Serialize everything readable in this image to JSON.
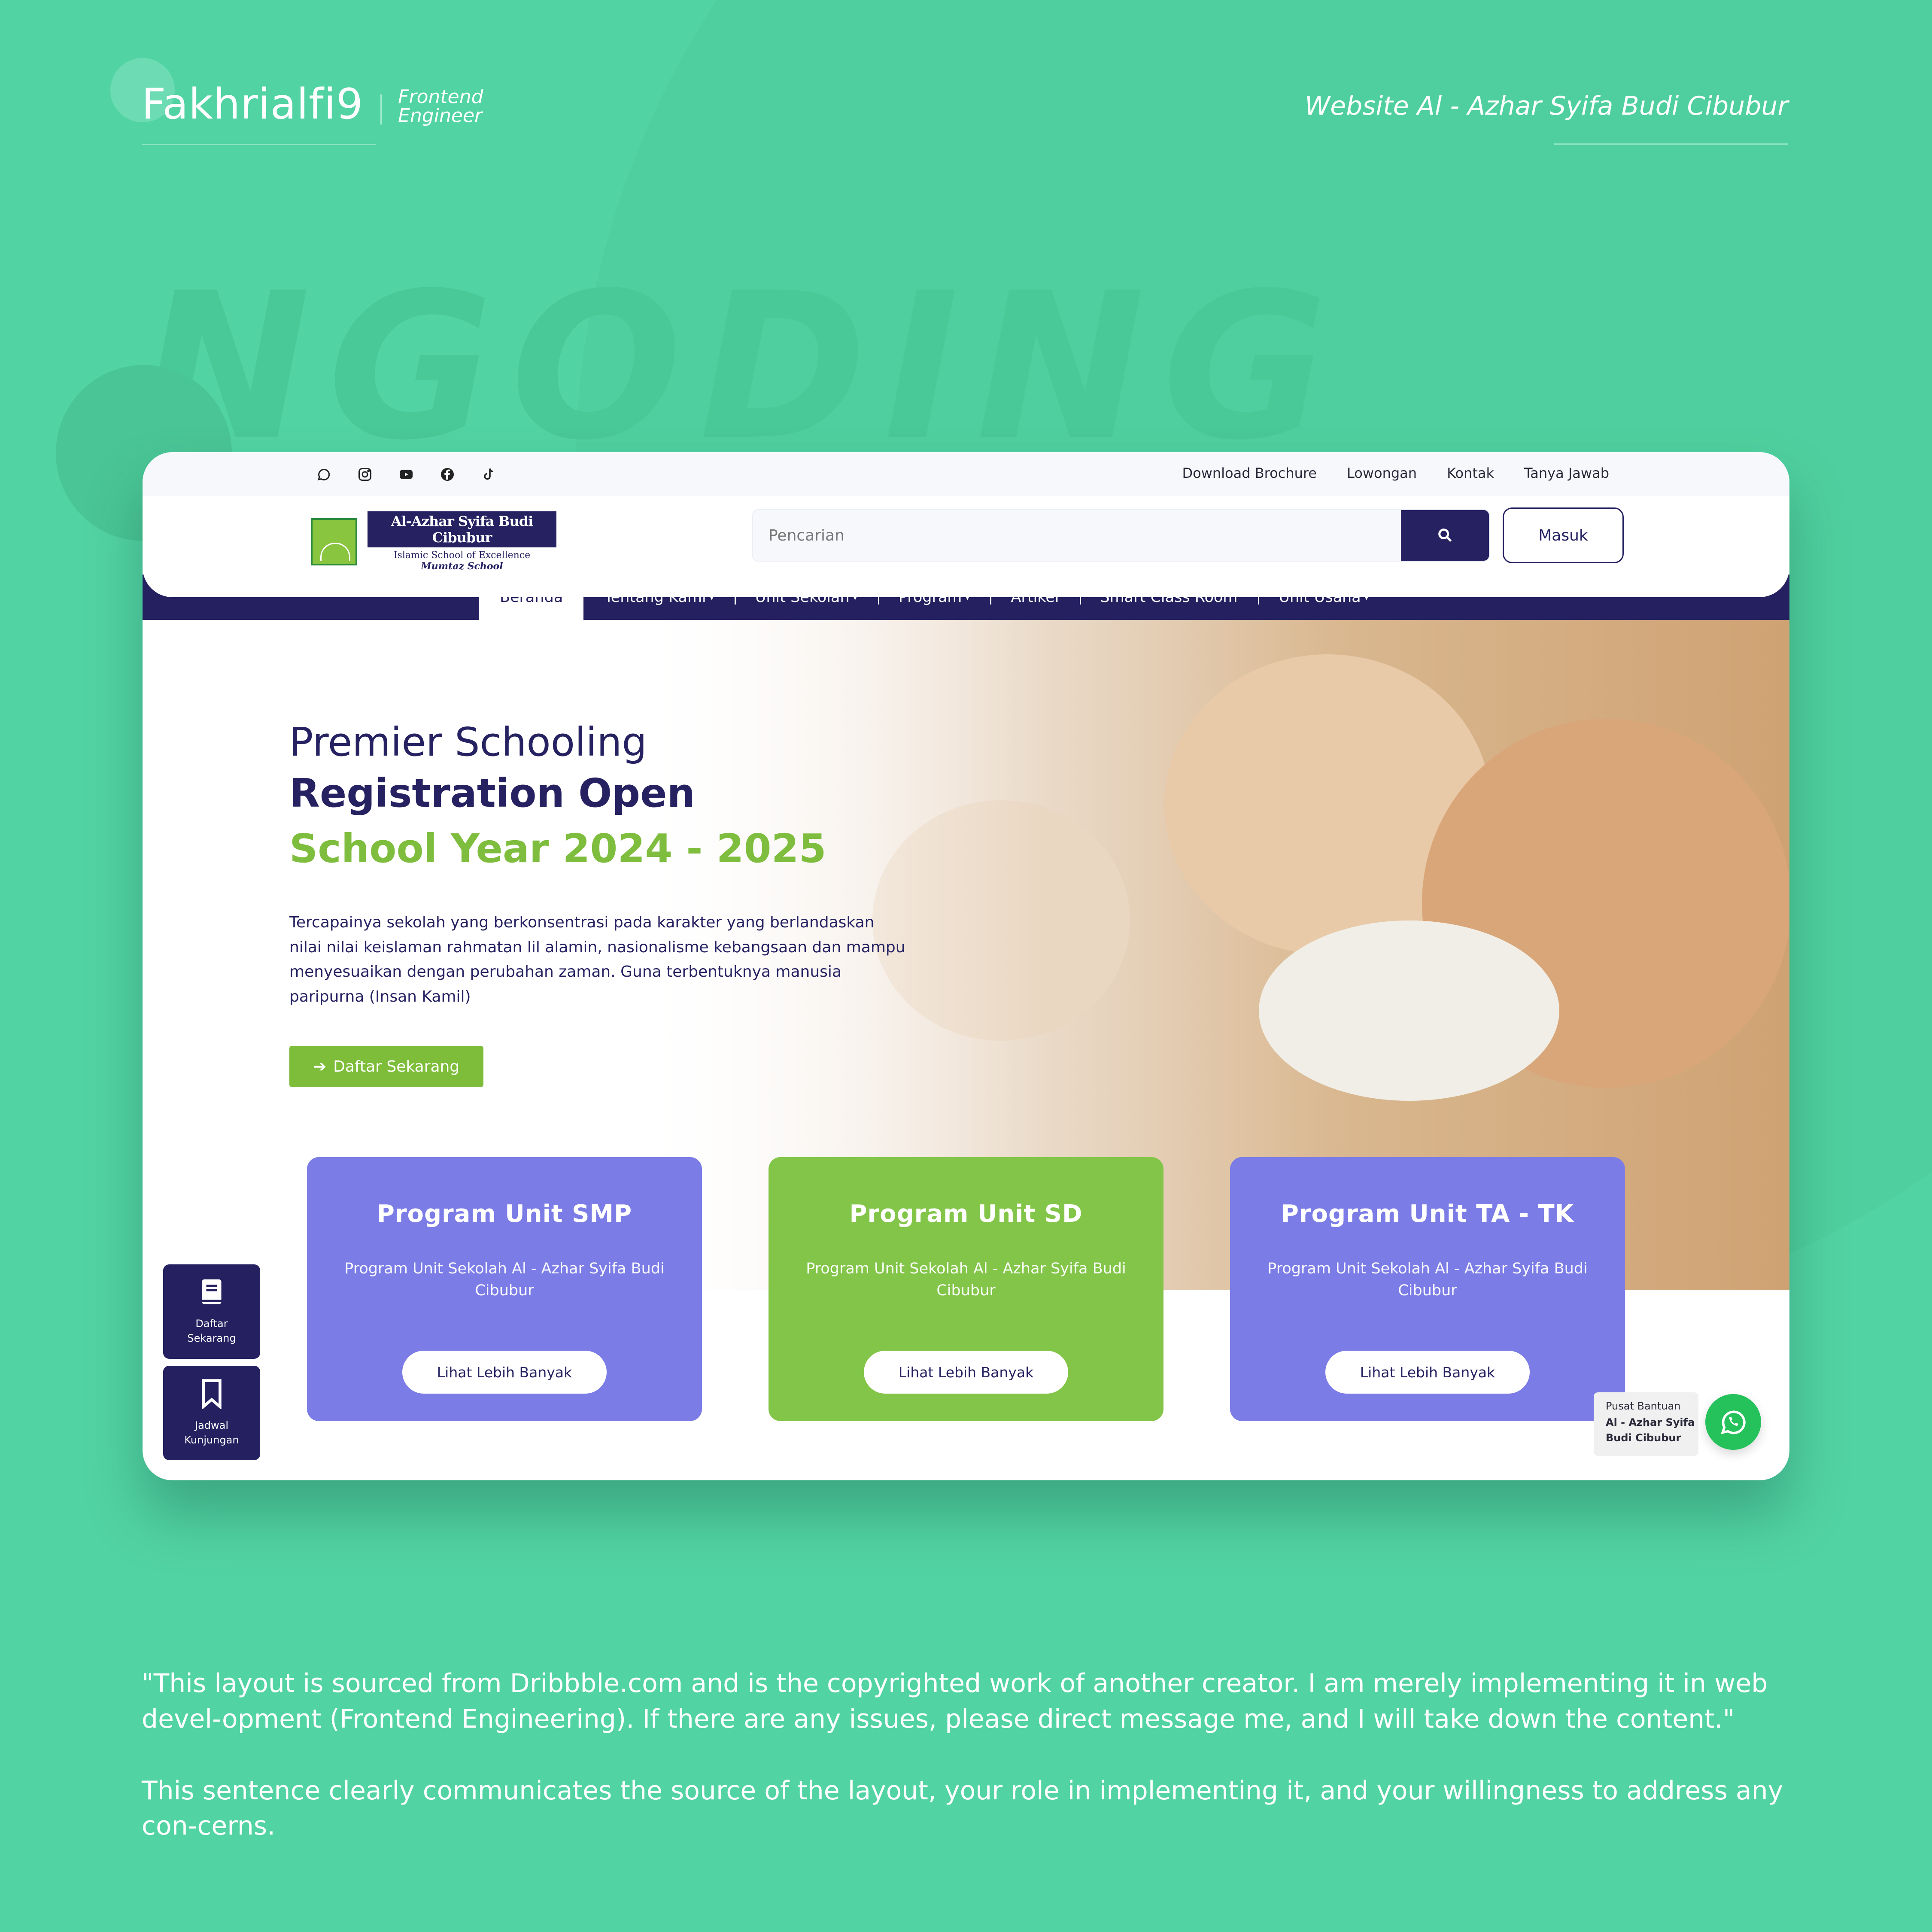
{
  "author": {
    "name": "Fakhrialfi9",
    "role_line1": "Frontend",
    "role_line2": "Engineer"
  },
  "page_caption": "Website Al - Azhar Syifa Budi Cibubur",
  "deco_text": "NGODING",
  "topbar": {
    "social_icons": [
      "whatsapp-icon",
      "instagram-icon",
      "youtube-icon",
      "facebook-icon",
      "tiktok-icon"
    ],
    "links": [
      "Download Brochure",
      "Lowongan",
      "Kontak",
      "Tanya Jawab"
    ]
  },
  "logo": {
    "title": "Al-Azhar Syifa Budi Cibubur",
    "subtitle": "Islamic School of Excellence",
    "subtitle2": "Mumtaz School"
  },
  "search": {
    "placeholder": "Pencarian",
    "button_icon": "search-icon"
  },
  "login_label": "Masuk",
  "nav": {
    "items": [
      "Beranda",
      "Tentang Kami",
      "Unit Sekolah",
      "Program",
      "Artikel",
      "Smart Class Room",
      "Unit Usaha"
    ],
    "caret": "▾"
  },
  "hero": {
    "line1": "Premier Schooling",
    "line2": "Registration Open",
    "line3": "School Year 2024 - 2025",
    "description": "Tercapainya sekolah yang berkonsentrasi pada karakter yang berlandaskan nilai nilai keislaman rahmatan lil alamin, nasionalisme kebangsaan dan mampu menyesuaikan dengan perubahan zaman. Guna terbentuknya manusia paripurna (Insan Kamil)",
    "cta_label": "Daftar Sekarang"
  },
  "cards": [
    {
      "title": "Program Unit SMP",
      "description": "Program Unit Sekolah Al - Azhar Syifa Budi Cibubur",
      "button": "Lihat Lebih Banyak"
    },
    {
      "title": "Program Unit SD",
      "description": "Program Unit Sekolah Al - Azhar Syifa Budi Cibubur",
      "button": "Lihat Lebih Banyak"
    },
    {
      "title": "Program Unit TA - TK",
      "description": "Program Unit Sekolah Al - Azhar Syifa Budi Cibubur",
      "button": "Lihat Lebih Banyak"
    }
  ],
  "side_tools": [
    {
      "icon": "book-icon",
      "label_line1": "Daftar",
      "label_line2": "Sekarang"
    },
    {
      "icon": "bookmark-icon",
      "label_line1": "Jadwal",
      "label_line2": "Kunjungan"
    }
  ],
  "help": {
    "line1": "Pusat Bantuan",
    "line2": "Al - Azhar Syifa",
    "line3": "Budi Cibubur"
  },
  "notes": [
    "\"This layout is sourced from Dribbble.com and is the copyrighted work of another creator. I am merely implementing it in web devel-opment (Frontend Engineering). If there are any issues, please direct message me, and I will take down the content.\"",
    "This sentence clearly communicates the source of the layout, your role in implementing it, and your willingness to address any con-cerns."
  ],
  "colors": {
    "background": "#52d3a4",
    "navy": "#252161",
    "green": "#7dbd3a",
    "card_blue": "#7b7ce6",
    "card_green": "#82c548",
    "whatsapp": "#25c15b"
  }
}
